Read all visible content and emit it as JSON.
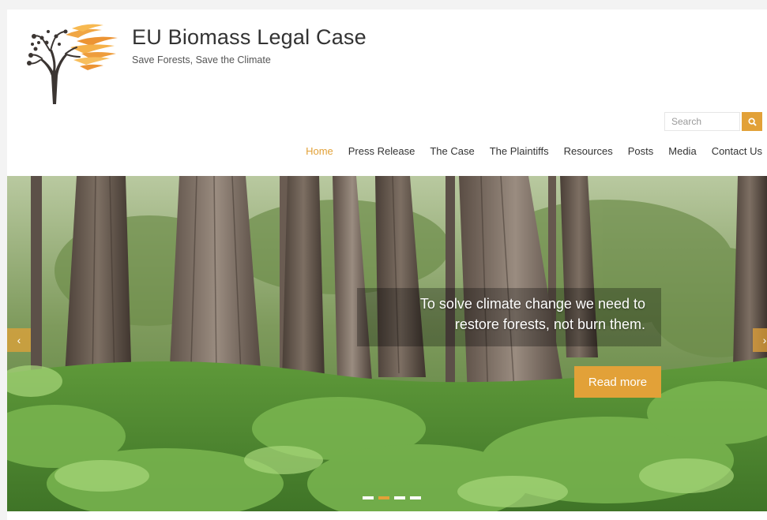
{
  "site": {
    "title": "EU Biomass Legal Case",
    "tagline": "Save Forests, Save the Climate"
  },
  "search": {
    "placeholder": "Search",
    "icon": "search-icon"
  },
  "nav": [
    {
      "label": "Home",
      "active": true
    },
    {
      "label": "Press Release",
      "active": false
    },
    {
      "label": "The Case",
      "active": false
    },
    {
      "label": "The Plaintiffs",
      "active": false
    },
    {
      "label": "Resources",
      "active": false
    },
    {
      "label": "Posts",
      "active": false
    },
    {
      "label": "Media",
      "active": false
    },
    {
      "label": "Contact Us",
      "active": false
    }
  ],
  "slider": {
    "caption_line1": "To solve climate change we need to",
    "caption_line2": "restore forests, not burn them.",
    "button": "Read more",
    "prev_icon": "chevron-left-icon",
    "next_icon": "chevron-right-icon",
    "slides": 4,
    "active_slide": 2
  },
  "colors": {
    "accent": "#e2a138",
    "text": "#333333"
  }
}
